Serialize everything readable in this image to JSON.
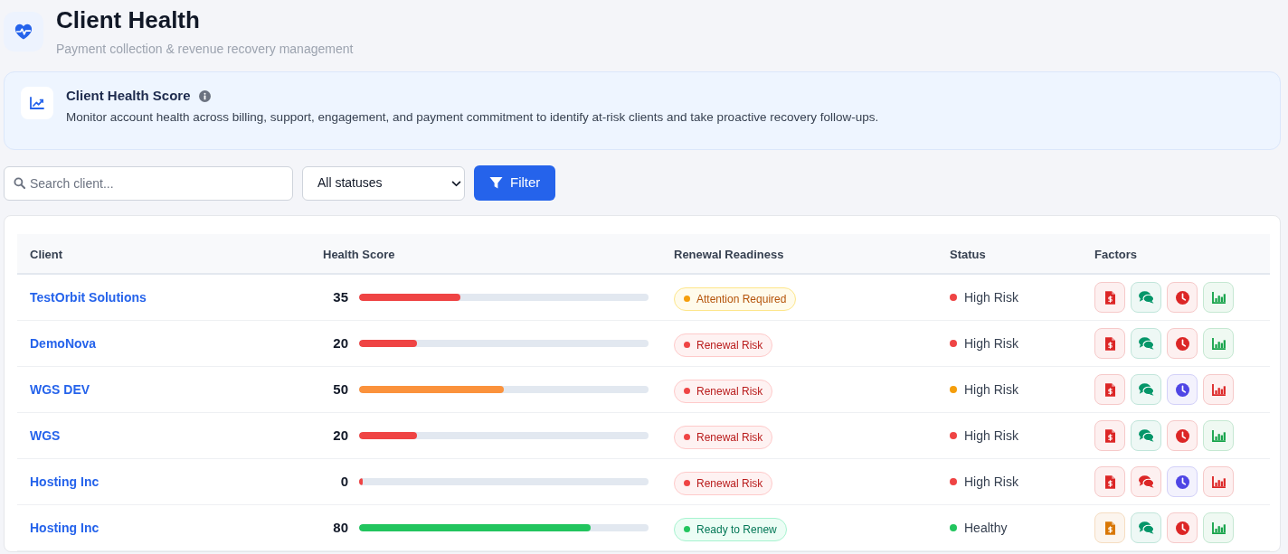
{
  "header": {
    "title": "Client Health",
    "subtitle": "Payment collection & revenue recovery management"
  },
  "info_card": {
    "title": "Client Health Score",
    "description": "Monitor account health across billing, support, engagement, and payment commitment to identify at-risk clients and take proactive recovery follow-ups."
  },
  "filters": {
    "search": {
      "placeholder": "Search client..."
    },
    "status_select": {
      "value": "All statuses"
    },
    "filter_button": {
      "label": "Filter"
    }
  },
  "table": {
    "columns": [
      "Client",
      "Health Score",
      "Renewal Readiness",
      "Status",
      "Factors"
    ],
    "rows": [
      {
        "client": "TestOrbit Solutions",
        "score": {
          "value": "35",
          "level": 0.35,
          "color": "#ef4444"
        },
        "readiness": {
          "label": "Attention Required",
          "kind": "attention"
        },
        "status": {
          "label": "High Risk",
          "color": "#ef4444"
        },
        "factors": [
          {
            "kind": "invoice",
            "color": "#dc2626"
          },
          {
            "kind": "chat",
            "color": "#059669"
          },
          {
            "kind": "clock",
            "color": "#dc2626"
          },
          {
            "kind": "chart",
            "color": "#16a34a"
          }
        ]
      },
      {
        "client": "DemoNova",
        "score": {
          "value": "20",
          "level": 0.2,
          "color": "#ef4444"
        },
        "readiness": {
          "label": "Renewal Risk",
          "kind": "risk"
        },
        "status": {
          "label": "High Risk",
          "color": "#ef4444"
        },
        "factors": [
          {
            "kind": "invoice",
            "color": "#dc2626"
          },
          {
            "kind": "chat",
            "color": "#059669"
          },
          {
            "kind": "clock",
            "color": "#dc2626"
          },
          {
            "kind": "chart",
            "color": "#16a34a"
          }
        ]
      },
      {
        "client": "WGS DEV",
        "score": {
          "value": "50",
          "level": 0.5,
          "color": "#fb923c"
        },
        "readiness": {
          "label": "Renewal Risk",
          "kind": "risk"
        },
        "status": {
          "label": "High Risk",
          "color": "#f59e0b"
        },
        "factors": [
          {
            "kind": "invoice",
            "color": "#dc2626"
          },
          {
            "kind": "chat",
            "color": "#059669"
          },
          {
            "kind": "clock",
            "color": "#4f46e5"
          },
          {
            "kind": "chart",
            "color": "#dc2626"
          }
        ]
      },
      {
        "client": "WGS",
        "score": {
          "value": "20",
          "level": 0.2,
          "color": "#ef4444"
        },
        "readiness": {
          "label": "Renewal Risk",
          "kind": "risk"
        },
        "status": {
          "label": "High Risk",
          "color": "#ef4444"
        },
        "factors": [
          {
            "kind": "invoice",
            "color": "#dc2626"
          },
          {
            "kind": "chat",
            "color": "#059669"
          },
          {
            "kind": "clock",
            "color": "#dc2626"
          },
          {
            "kind": "chart",
            "color": "#16a34a"
          }
        ]
      },
      {
        "client": "Hosting Inc",
        "score": {
          "value": "0",
          "level": 0,
          "color": "#ef4444"
        },
        "readiness": {
          "label": "Renewal Risk",
          "kind": "risk"
        },
        "status": {
          "label": "High Risk",
          "color": "#ef4444"
        },
        "factors": [
          {
            "kind": "invoice",
            "color": "#dc2626"
          },
          {
            "kind": "chat",
            "color": "#dc2626"
          },
          {
            "kind": "clock",
            "color": "#4f46e5"
          },
          {
            "kind": "chart",
            "color": "#dc2626"
          }
        ]
      },
      {
        "client": "Hosting Inc",
        "score": {
          "value": "80",
          "level": 0.8,
          "color": "#22c55e"
        },
        "readiness": {
          "label": "Ready to Renew",
          "kind": "ready"
        },
        "status": {
          "label": "Healthy",
          "color": "#22c55e"
        },
        "factors": [
          {
            "kind": "invoice",
            "color": "#d97706"
          },
          {
            "kind": "chat",
            "color": "#059669"
          },
          {
            "kind": "clock",
            "color": "#dc2626"
          },
          {
            "kind": "chart",
            "color": "#16a34a"
          }
        ]
      }
    ]
  }
}
